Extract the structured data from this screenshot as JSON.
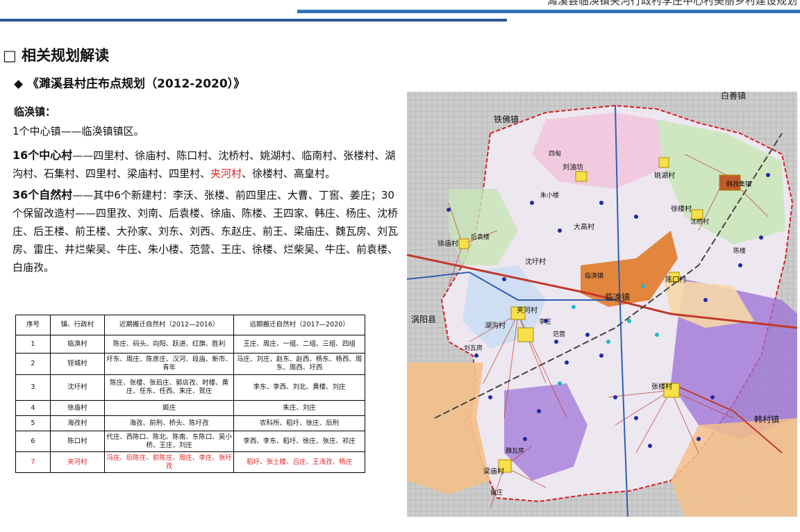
{
  "header": {
    "title": "濉溪县临涣镇夹河行政村李庄中心村美丽乡村建设规划"
  },
  "section": {
    "title": "□ 相关规划解读"
  },
  "subsection": {
    "title": "◆ 《濉溪县村庄布点规划（2012-2020）》"
  },
  "content": {
    "town_label": "临涣镇：",
    "line1": "1个中心镇——临涣镇镇区。",
    "line2_bold": "16个中心村",
    "line2_a": "——四里村、徐庙村、陈口村、沈桥村、姚湖村、临南村、张楼村、湖沟村、石集村、四里村、梁庙村、四里村、",
    "line2_red": "夹河村",
    "line2_b": "、徐楼村、高皇村。",
    "line3_bold": "36个自然村",
    "line3_text": "——其中6个新建村：李沃、张楼、前四里庄、大曹、丁窖、姜庄；30个保留改造村——四里孜、刘南、后袁楼、徐庙、陈楼、王四家、韩庄、杨庄、沈桥庄、后王楼、前王楼、大孙家、刘东、刘西、东赵庄、前王、梁庙庄、魏瓦房、刘瓦房、雷庄、井烂柴吴、牛庄、朱小楼、范营、王庄、徐楼、烂柴吴、牛庄、前袁楼、白庙孜。"
  },
  "table": {
    "headers": [
      "序号",
      "镇、行政村",
      "近期搬迁自然村（2012—2016）",
      "远期搬迁自然村（2017—2020）"
    ],
    "rows": [
      [
        "1",
        "临涣村",
        "陈庄、码头、向阳、跃进、红旗、胜利",
        "王庄、周庄、一组、二组、三组、四组"
      ],
      [
        "2",
        "铚城村",
        "圩东、周庄、陈彦庄、汉河、段庙、新市、青年",
        "马庄、刘庄、赵东、赵西、杨东、杨西、周东、周西、圩西"
      ],
      [
        "3",
        "沈圩村",
        "陈庄、张楼、张后庄、郭店孜、时楼、黄庄、任东、任西、朱庄、贺庄",
        "李东、李西、刘北、黄楼、刘庄"
      ],
      [
        "4",
        "徐庙村",
        "姬庄",
        "朱庄、刘庄"
      ],
      [
        "5",
        "海孜村",
        "海孜、前刑、桥头、陈圩孜",
        "农科所、稻圩、徐庄、后刑"
      ],
      [
        "6",
        "陈口村",
        "代庄、西陈口、陈北、陈南、东陈口、吴小桥、王庄、刘庄",
        "李西、李东、稻圩、徐庄、张庄、祁庄"
      ],
      [
        "7",
        "夹河村",
        "冯庄、后陈庄、前陈庄、周庄、李庄、张圩孜",
        "稻圩、张土楼、吕庄、王浅孜、杨庄"
      ]
    ]
  },
  "map": {
    "labels": {
      "baishan": "白善镇",
      "tiefo": "铁佛镇",
      "guoyang": "涡阳县",
      "hancun": "韩村镇",
      "linhuan_town": "临涣镇",
      "linhuan_zhen": "临涣镇",
      "yaohu": "姚湖村",
      "xulou": "徐楼村",
      "xumiao": "徐庙村",
      "shenwei": "沈圩村",
      "jiahe": "夹河村",
      "huguo": "湖沟村",
      "zhanglou": "张楼村",
      "lianmiao": "梁庙村",
      "dagao": "大高村",
      "liuyougou": "刘油坊",
      "chenkou": "陈口村",
      "houyuanlou": "后袁楼",
      "ganzi": "韩孜集镇",
      "fanying": "范营",
      "weiwafang": "魏瓦房",
      "liuwafang": "刘瓦房",
      "leizhuang": "雷庄",
      "chenlou": "陈楼",
      "sidian": "四甸",
      "zhuxiaolou": "朱小楼",
      "chenqiao": "沈桥村",
      "lizhuang": "李庄"
    },
    "colors": {
      "purple": "#9b6fd6",
      "orange": "#f4c08a",
      "pink": "#f2c4dc",
      "green": "#c8e6b8",
      "blue": "#c9dcf2",
      "core": "#e07b2a"
    }
  }
}
